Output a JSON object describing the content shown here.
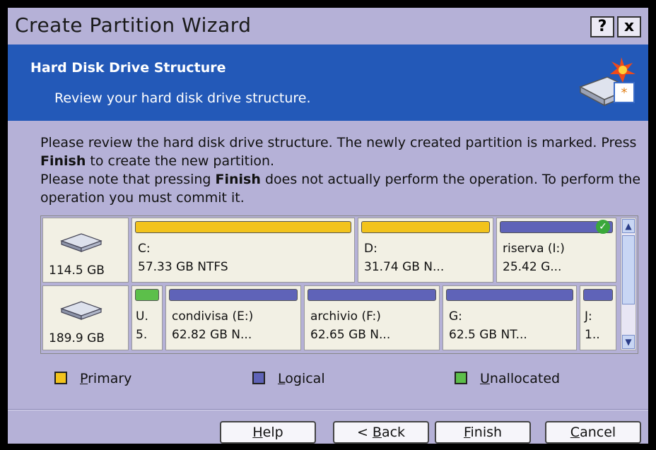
{
  "window": {
    "title": "Create Partition Wizard",
    "help_label": "?",
    "close_label": "x"
  },
  "header": {
    "title": "Hard Disk Drive Structure",
    "subtitle": "Review your hard disk drive structure."
  },
  "description": {
    "p1_a": "Please review the hard disk drive structure. The newly created partition is marked. Press ",
    "p1_bold": "Finish",
    "p1_b": " to create the new partition.",
    "p2_a": "Please note that pressing ",
    "p2_bold": "Finish",
    "p2_b": " does not actually perform the operation. To perform the operation you must commit it."
  },
  "disks": [
    {
      "size": "114.5 GB",
      "partitions": [
        {
          "type": "primary",
          "name": "C:",
          "detail": "57.33 GB  NTFS"
        },
        {
          "type": "primary",
          "name": "D:",
          "detail": "31.74 GB  N..."
        },
        {
          "type": "logical",
          "name": "riserva (I:)",
          "detail": "25.42 G...",
          "marked": true
        }
      ]
    },
    {
      "size": "189.9 GB",
      "partitions": [
        {
          "type": "unallocated",
          "name": "U.",
          "detail": "5."
        },
        {
          "type": "logical",
          "name": "condivisa (E:)",
          "detail": "62.82 GB  N..."
        },
        {
          "type": "logical",
          "name": "archivio (F:)",
          "detail": "62.65 GB  N..."
        },
        {
          "type": "logical",
          "name": "G:",
          "detail": "62.5 GB  NT..."
        },
        {
          "type": "logical",
          "name": "J:",
          "detail": "1.."
        }
      ]
    }
  ],
  "legend": {
    "primary_key": "P",
    "primary_rest": "rimary",
    "logical_key": "L",
    "logical_rest": "ogical",
    "unalloc_key": "U",
    "unalloc_rest": "nallocated"
  },
  "buttons": {
    "help_key": "H",
    "help_rest": "elp",
    "back_prefix": "< ",
    "back_key": "B",
    "back_rest": "ack",
    "finish_key": "F",
    "finish_rest": "inish",
    "cancel_key": "C",
    "cancel_rest": "ancel"
  },
  "colors": {
    "primary": "#f2c31c",
    "logical": "#5f63b8",
    "unallocated": "#5cbf4a",
    "header_bg": "#2359b8",
    "window_bg": "#b5b1d7"
  },
  "icons": {
    "titlebar": [
      "help-icon",
      "close-icon"
    ],
    "header": "disk-wizard-icon",
    "disk": "hard-disk-icon",
    "marked": "check-icon",
    "scroll": [
      "scroll-up-icon",
      "scroll-down-icon"
    ]
  }
}
